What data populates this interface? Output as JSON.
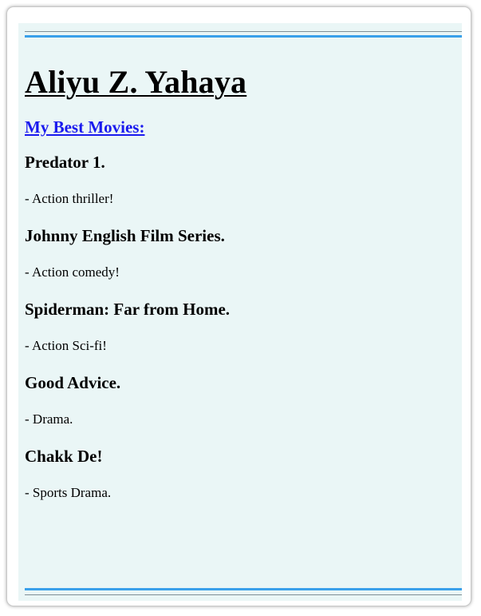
{
  "header": {
    "name": "Aliyu Z. Yahaya",
    "link_label": "My Best Movies:"
  },
  "movies": [
    {
      "title": "Predator 1.",
      "description": "- Action thriller!"
    },
    {
      "title": "Johnny English Film Series.",
      "description": "- Action comedy!"
    },
    {
      "title": "Spiderman: Far from Home.",
      "description": "- Action Sci-fi!"
    },
    {
      "title": "Good Advice.",
      "description": "- Drama."
    },
    {
      "title": "Chakk De!",
      "description": "- Sports Drama."
    }
  ],
  "colors": {
    "panel_background": "#eaf6f6",
    "accent_rule": "#3aa0ea",
    "link": "#1a1aee"
  }
}
